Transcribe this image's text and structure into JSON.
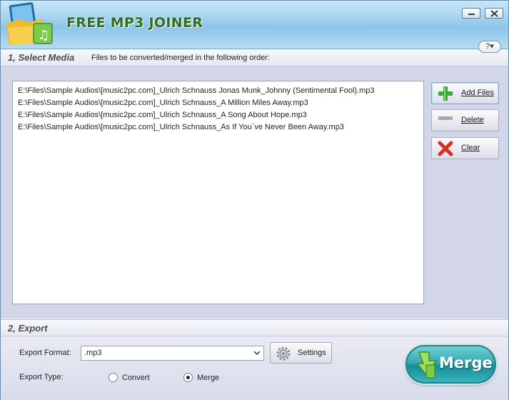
{
  "app": {
    "title": "FREE MP3 JOINER"
  },
  "titlebar": {
    "help_label": "?▾",
    "minimize_icon": "minimize-icon",
    "close_icon": "close-icon"
  },
  "select_media": {
    "section_title": "1, Select Media",
    "caption": "Files to be converted/merged in the following order:",
    "files": [
      "E:\\Files\\Sample Audios\\[music2pc.com]_Ulrich Schnauss Jonas Munk_Johnny (Sentimental Fool).mp3",
      "E:\\Files\\Sample Audios\\[music2pc.com]_Ulrich Schnauss_A Million Miles Away.mp3",
      "E:\\Files\\Sample Audios\\[music2pc.com]_Ulrich Schnauss_A Song About Hope.mp3",
      "E:\\Files\\Sample Audios\\[music2pc.com]_Ulrich Schnauss_As If You`ve Never Been Away.mp3"
    ],
    "buttons": {
      "add_files": "Add Files",
      "delete": "Delete",
      "clear": "Clear"
    }
  },
  "export": {
    "section_title": "2, Export",
    "format_label": "Export Format:",
    "format_value": ".mp3",
    "settings_label": "Settings",
    "type_label": "Export Type:",
    "type_options": [
      {
        "label": "Convert",
        "selected": false
      },
      {
        "label": "Merge",
        "selected": true
      }
    ],
    "merge_button": "Merge"
  },
  "colors": {
    "title_green": "#2e6d1c",
    "merge_teal": "#178d9a",
    "add_green": "#3aa83a",
    "clear_red": "#d9301e"
  }
}
